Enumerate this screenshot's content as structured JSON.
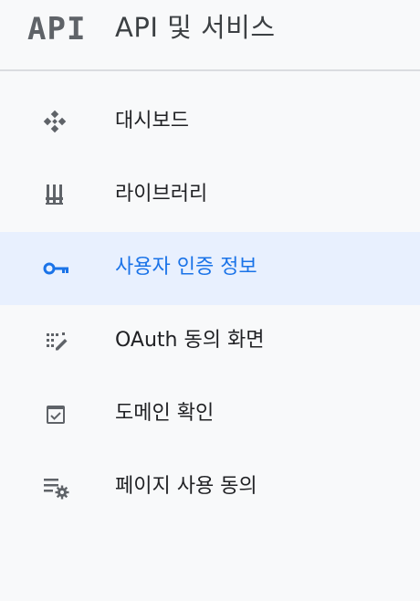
{
  "header": {
    "logo_text": "API",
    "title": "API 및 서비스"
  },
  "nav": {
    "items": [
      {
        "label": "대시보드",
        "icon": "dashboard-icon",
        "active": false
      },
      {
        "label": "라이브러리",
        "icon": "library-icon",
        "active": false
      },
      {
        "label": "사용자 인증 정보",
        "icon": "key-icon",
        "active": true
      },
      {
        "label": "OAuth 동의 화면",
        "icon": "oauth-consent-icon",
        "active": false
      },
      {
        "label": "도메인 확인",
        "icon": "domain-verification-icon",
        "active": false
      },
      {
        "label": "페이지 사용 동의",
        "icon": "page-usage-settings-icon",
        "active": false
      }
    ]
  },
  "colors": {
    "active_background": "#e8f0fe",
    "active_text": "#1a73e8",
    "icon_gray": "#5f6368",
    "sidebar_background": "#f8f9fa"
  }
}
